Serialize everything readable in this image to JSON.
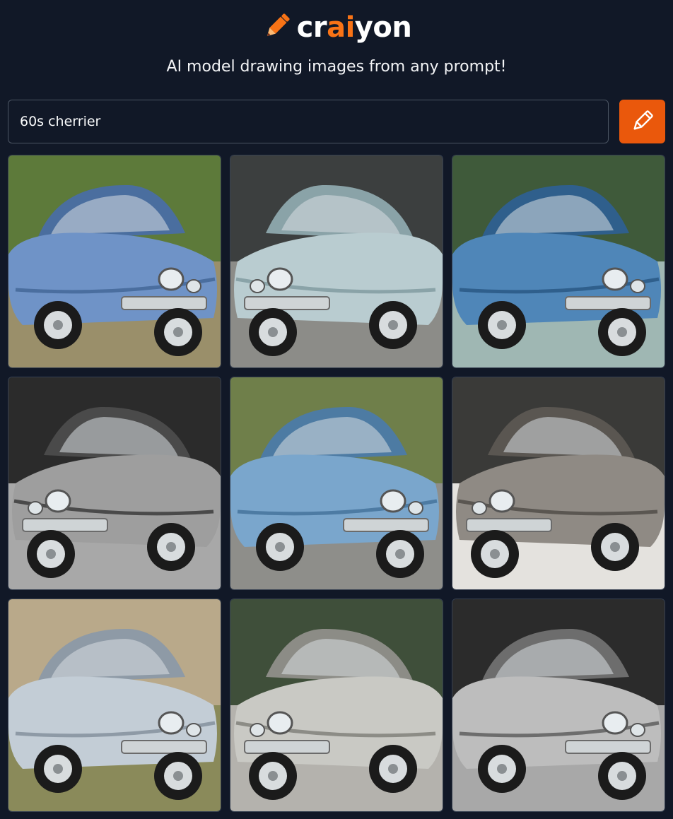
{
  "brand": {
    "name_prefix": "cr",
    "name_accent": "ai",
    "name_suffix": "yon",
    "accent_color": "#f97316",
    "logo_icon": "pencil-icon"
  },
  "tagline": "AI model drawing images from any prompt!",
  "prompt": {
    "value": "60s cherrier",
    "button_icon": "pencil-icon",
    "button_color": "#ea580c"
  },
  "results": [
    {
      "plate": "",
      "scene": "grass",
      "body": "#6f93c7",
      "shade": "#4a6e9f"
    },
    {
      "plate": "",
      "scene": "road",
      "body": "#b9ccd0",
      "shade": "#8aa3a8"
    },
    {
      "plate": "",
      "scene": "hedge",
      "body": "#4f86b8",
      "shade": "#2f5f8c"
    },
    {
      "plate": "",
      "scene": "mono-dark",
      "body": "#9e9e9e",
      "shade": "#4a4a4a"
    },
    {
      "plate": "",
      "scene": "grass-road",
      "body": "#7aa6cc",
      "shade": "#4d7ba3"
    },
    {
      "plate": "",
      "scene": "mono-light",
      "body": "#8f8a84",
      "shade": "#5a5651"
    },
    {
      "plate": "",
      "scene": "field",
      "body": "#c3cdd6",
      "shade": "#8e9aa6"
    },
    {
      "plate": "",
      "scene": "hedge-grey",
      "body": "#c9c9c4",
      "shade": "#8c8c86"
    },
    {
      "plate": "",
      "scene": "mono-dark",
      "body": "#bdbdbd",
      "shade": "#6d6d6d"
    }
  ]
}
